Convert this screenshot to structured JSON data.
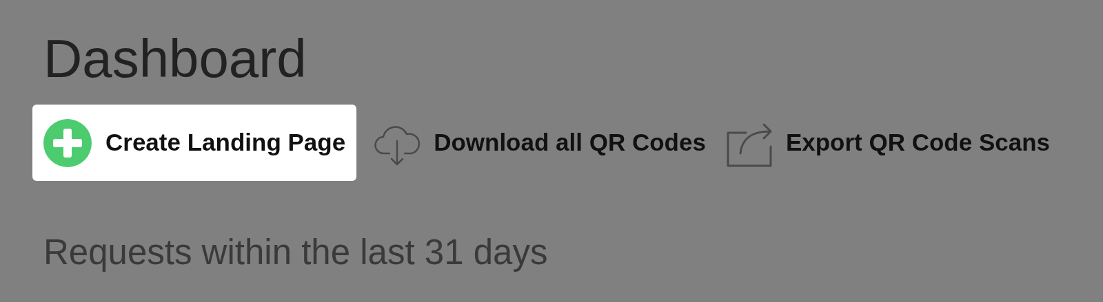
{
  "title": "Dashboard",
  "actions": [
    {
      "label": "Create Landing Page",
      "kind": "create"
    },
    {
      "label": "Download all QR Codes",
      "kind": "download"
    },
    {
      "label": "Export QR Code Scans",
      "kind": "export"
    }
  ],
  "subtitle": "Requests within the last 31 days"
}
